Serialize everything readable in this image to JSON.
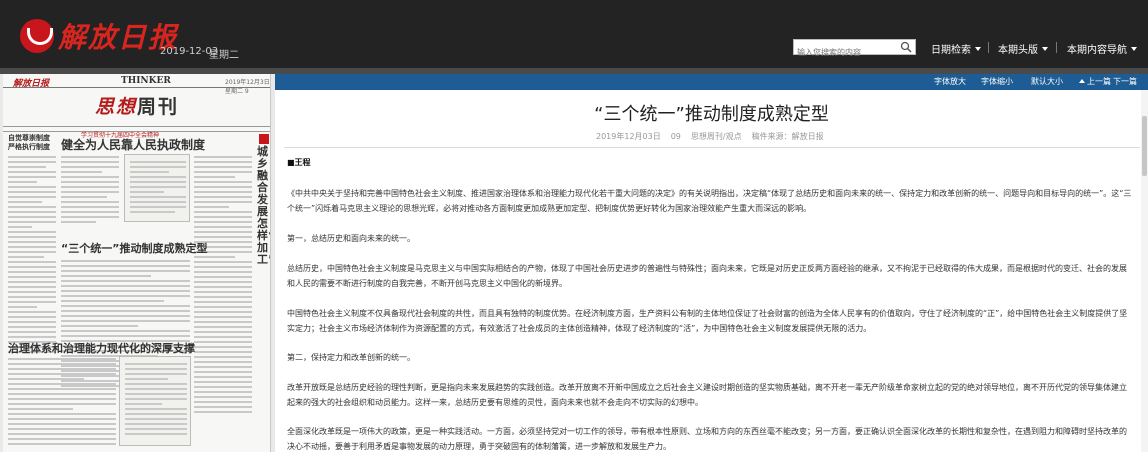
{
  "header": {
    "logo_text": "解放日报",
    "date": "2019-12-03",
    "weekday": "星期二",
    "search_placeholder": "输入您搜索的内容",
    "nav": [
      "日期检索",
      "本期头版",
      "本期内容导航"
    ]
  },
  "thumbnail": {
    "masthead_logo": "解放日报",
    "masthead_thinker": "THINKER",
    "masthead_right": "2019年12月3日 星期二 9",
    "weekly_red": "思想",
    "weekly_black": "周刊",
    "col1_title": "自觉尊崇制度 严格执行制度",
    "ribbon_text": "学习贯彻十九届四中全会精神",
    "main_headline": "健全为人民靠人民执政制度",
    "sub_headline": "“三个统一”推动制度成熟定型",
    "bottom_headline": "治理体系和治理能力现代化的深厚支撑",
    "vertical_headline": "城乡融合发展怎样“深加工”"
  },
  "toolbar": {
    "font_larger": "字体放大",
    "font_smaller": "字体缩小",
    "font_default": "默认大小",
    "prev": "上一篇",
    "next": "下一篇"
  },
  "article": {
    "title": "“三个统一”推动制度成熟定型",
    "date": "2019年12月03日",
    "page": "09",
    "section": "思想周刊/观点",
    "source": "稿件来源：解放日报",
    "author": "■王程",
    "paragraphs": [
      "《中共中央关于坚持和完善中国特色社会主义制度、推进国家治理体系和治理能力现代化若干重大问题的决定》的有关说明指出，决定稿“体现了总结历史和面向未来的统一、保持定力和改革创新的统一、问题导向和目标导向的统一”。这“三个统一”闪烁着马克思主义理论的思想光辉，必将对推动各方面制度更加成熟更加定型、把制度优势更好转化为国家治理效能产生重大而深远的影响。",
      "第一，总结历史和面向未来的统一。",
      "总结历史，中国特色社会主义制度是马克思主义与中国实际相结合的产物，体现了中国社会历史进步的普遍性与特殊性；面向未来，它既是对历史正反两方面经验的继承，又不拘泥于已经取得的伟大成果，而是根据时代的变迁、社会的发展和人民的需要不断进行制度的自我完善，不断开创马克思主义中国化的新境界。",
      "中国特色社会主义制度不仅具备现代社会制度的共性，而且具有独特的制度优势。在经济制度方面，生产资料公有制的主体地位保证了社会财富的创造为全体人民享有的价值取向，守住了经济制度的“正”，给中国特色社会主义制度提供了坚实定力；社会主义市场经济体制作为资源配置的方式，有效激活了社会成员的主体创造精神，体现了经济制度的“活”，为中国特色社会主义制度发展提供无限的活力。",
      "第二，保持定力和改革创新的统一。",
      "改革开放既是总结历史经验的理性判断，更是指向未来发展趋势的实践创造。改革开放离不开新中国成立之后社会主义建设时期创造的坚实物质基础，离不开老一辈无产阶级革命家树立起的党的绝对领导地位，离不开历代党的领导集体建立起来的强大的社会组织和动员能力。这样一来，总结历史要有思维的灵性，面向未来也就不会走向不切实际的幻想中。",
      "全面深化改革既是一项伟大的政策，更是一种实践活动。一方面，必须坚持党对一切工作的领导，带有根本性原则、立场和方向的东西丝毫不能改变；另一方面，要正确认识全面深化改革的长期性和复杂性，在遇到阻力和障碍时坚持改革的决心不动摇，要善于利用矛盾是事物发展的动力原理，勇于突破固有的体制藩篱，进一步解放和发展生产力。"
    ]
  }
}
